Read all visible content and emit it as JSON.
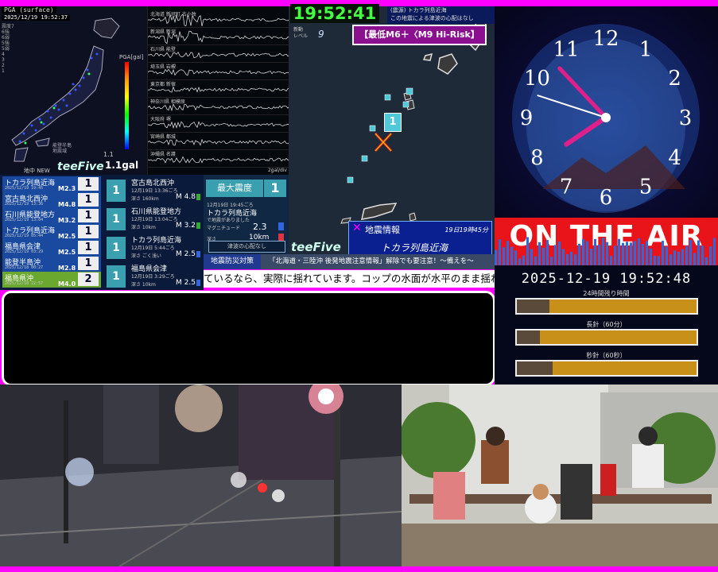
{
  "quake_map": {
    "header": "PGA (surface)",
    "timestamp": "2025/12/19 19:52:37",
    "legend": [
      "震度7",
      "6強",
      "6弱",
      "5強",
      "5弱",
      "4",
      "3",
      "2",
      "1"
    ],
    "pga_label": "PGA[gal]",
    "pga_value": "1.1gal",
    "pga_small": "1.1",
    "map_note": "能登半島\n地震域"
  },
  "waveforms": {
    "stations": [
      "北海道 新冠町 古小牧",
      "新潟県 新潟",
      "石川県 能登",
      "埼玉県 岩槻",
      "東京都 新宿",
      "神奈川県 相模原",
      "大阪府 堺",
      "宮崎県 都城",
      "沖縄県 名護"
    ],
    "unit": "2gal/div"
  },
  "quake_list": {
    "header": "地中 NEW",
    "logo": "teeFive",
    "items": [
      {
        "name": "トカラ列島近海",
        "date": "2025/12/19 19:45",
        "mag": "M2.3",
        "int": "1"
      },
      {
        "name": "宮古島北西沖",
        "date": "2025/12/19 13:36",
        "mag": "M4.8",
        "int": "1"
      },
      {
        "name": "石川県能登地方",
        "date": "2025/12/19 13:04",
        "mag": "M3.2",
        "int": "1"
      },
      {
        "name": "トカラ列島近海",
        "date": "2025/12/19 05:44",
        "mag": "M2.5",
        "int": "1"
      },
      {
        "name": "福島県会津",
        "date": "2025/12/19 03:29",
        "mag": "M2.5",
        "int": "1"
      },
      {
        "name": "能登半島沖",
        "date": "2025/12/18 00:27",
        "mag": "M2.8",
        "int": "1"
      },
      {
        "name": "福島県沖",
        "date": "2025/12/18 22:57",
        "mag": "M4.0",
        "int": "2"
      }
    ]
  },
  "quake_detail": {
    "items": [
      {
        "int": "1",
        "name": "宮古島北西沖",
        "date": "12月19日 13:36ごろ",
        "depth": "深さ 160km",
        "mag": "M 4.8",
        "color": "#33aa33"
      },
      {
        "int": "1",
        "name": "石川県能登地方",
        "date": "12月19日 13:04ごろ",
        "depth": "深さ 10km",
        "mag": "M 3.2",
        "color": "#33aa33"
      },
      {
        "int": "1",
        "name": "トカラ列島近海",
        "date": "12月19日 5:44ごろ",
        "depth": "深さ ごく浅い",
        "mag": "M 2.5",
        "color": "#3366dd"
      },
      {
        "int": "1",
        "name": "福島県会津",
        "date": "12月19日 3:29ごろ",
        "depth": "深さ 10km",
        "mag": "M 2.5",
        "color": "#3366dd"
      }
    ]
  },
  "max_box": {
    "label": "最大震度",
    "value": "1",
    "date": "12月19日 19:45ごろ",
    "location": "トカラ列島近海",
    "sub": "で地震がありました",
    "mag_label": "マグニチュード",
    "mag_value": "2.3",
    "depth_label": "深さ",
    "depth_value": "10km",
    "tsunami": "津波の心配なし"
  },
  "center": {
    "clock": "19:52:41",
    "banner_line1": "(震源) トカラ列島近海",
    "banner_line2": "この地震による津波の心配はなし",
    "level_label": "新動\nレベル",
    "level_value": "9",
    "risk": "【最低M6＋〈M9 Hi-Risk】",
    "intensity_marker": "1",
    "info_title": "地震情報",
    "info_time": "19日19時45分",
    "info_location": "トカラ列島近海",
    "info_x": "✕",
    "logo": "teeFive"
  },
  "ticker": {
    "label": "地震防災対策",
    "alert": "「北海道・三陸沖 後発地震注意情報」解除でも要注意！〜備えを〜",
    "main": "ているなら、実際に揺れています。コップの水面が水平のまま揺れな"
  },
  "analog_clock": {
    "numerals": [
      "12",
      "1",
      "2",
      "3",
      "4",
      "5",
      "6",
      "7",
      "8",
      "9",
      "10",
      "11"
    ],
    "hour": 7,
    "minute": 52,
    "second": 48
  },
  "on_air": {
    "text": "ON THE AIR",
    "datetime": "2025-12-19 19:52:48",
    "bars": [
      {
        "label": "24時間残り時間",
        "fill": 0.18
      },
      {
        "label": "長針（60分）",
        "fill": 0.13
      },
      {
        "label": "秒針（60秒）",
        "fill": 0.2
      }
    ]
  },
  "cameras": {
    "left_name": "street-camera",
    "right_name": "park-camera"
  }
}
